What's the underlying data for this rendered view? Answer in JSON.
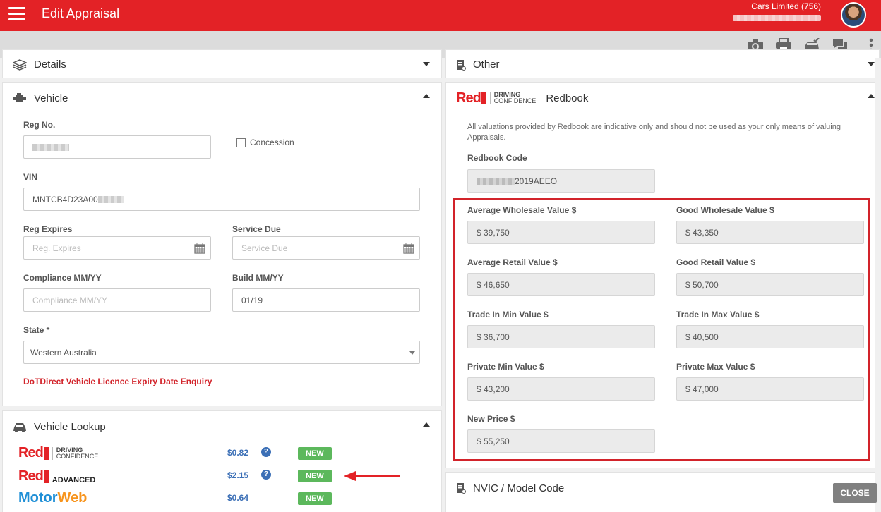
{
  "header": {
    "app_title": "Edit Appraisal",
    "dealer_name": "Cars Limited (756)"
  },
  "toolbar": {
    "icons": [
      "camera-icon",
      "printer-icon",
      "car-check-icon",
      "chat-icon",
      "more-vert-icon"
    ]
  },
  "left": {
    "details": {
      "title": "Details"
    },
    "vehicle": {
      "title": "Vehicle",
      "reg_no": {
        "label": "Reg No.",
        "value": ""
      },
      "concession": {
        "label": "Concession",
        "checked": false
      },
      "vin": {
        "label": "VIN",
        "value": "MNTCB4D23A00"
      },
      "reg_expires": {
        "label": "Reg Expires",
        "placeholder": "Reg. Expires"
      },
      "service_due": {
        "label": "Service Due",
        "placeholder": "Service Due"
      },
      "compliance": {
        "label": "Compliance MM/YY",
        "placeholder": "Compliance MM/YY"
      },
      "build": {
        "label": "Build MM/YY",
        "value": "01/19"
      },
      "state": {
        "label": "State *",
        "value": "Western Australia"
      },
      "dot_link": "DoTDirect Vehicle Licence Expiry Date Enquiry"
    },
    "lookup": {
      "title": "Vehicle Lookup",
      "providers": [
        {
          "brand": "Red",
          "sub1": "DRIVING",
          "sub2": "CONFIDENCE",
          "price": "$0.82",
          "badge": "NEW",
          "help": "?"
        },
        {
          "brand": "Red",
          "sub1": "ADVANCED",
          "sub2": "",
          "price": "$2.15",
          "badge": "NEW",
          "help": "?"
        },
        {
          "brand": "MotorWeb",
          "price": "$0.64",
          "badge": "NEW"
        }
      ]
    }
  },
  "right": {
    "other": {
      "title": "Other"
    },
    "redbook": {
      "title": "Redbook",
      "logo_word": "Red",
      "logo_sub1": "DRIVING",
      "logo_sub2": "CONFIDENCE",
      "notice": "All valuations provided by Redbook are indicative only and should not be used as your only means of valuing Appraisals.",
      "code": {
        "label": "Redbook Code",
        "value": "2019AEEO"
      },
      "values": [
        {
          "label": "Average Wholesale Value $",
          "value": "$ 39,750"
        },
        {
          "label": "Good Wholesale Value $",
          "value": "$ 43,350"
        },
        {
          "label": "Average Retail Value $",
          "value": "$ 46,650"
        },
        {
          "label": "Good Retail Value $",
          "value": "$ 50,700"
        },
        {
          "label": "Trade In Min Value $",
          "value": "$ 36,700"
        },
        {
          "label": "Trade In Max Value $",
          "value": "$ 40,500"
        },
        {
          "label": "Private Min Value $",
          "value": "$ 43,200"
        },
        {
          "label": "Private Max Value $",
          "value": "$ 47,000"
        },
        {
          "label": "New Price $",
          "value": "$ 55,250"
        }
      ]
    },
    "nvic": {
      "title": "NVIC / Model Code"
    }
  },
  "close_label": "CLOSE",
  "colors": {
    "brand_red": "#e32226",
    "toolbar_gray": "#dcdcdc",
    "new_badge_green": "#5cb85c",
    "price_blue": "#3b6fb6"
  }
}
